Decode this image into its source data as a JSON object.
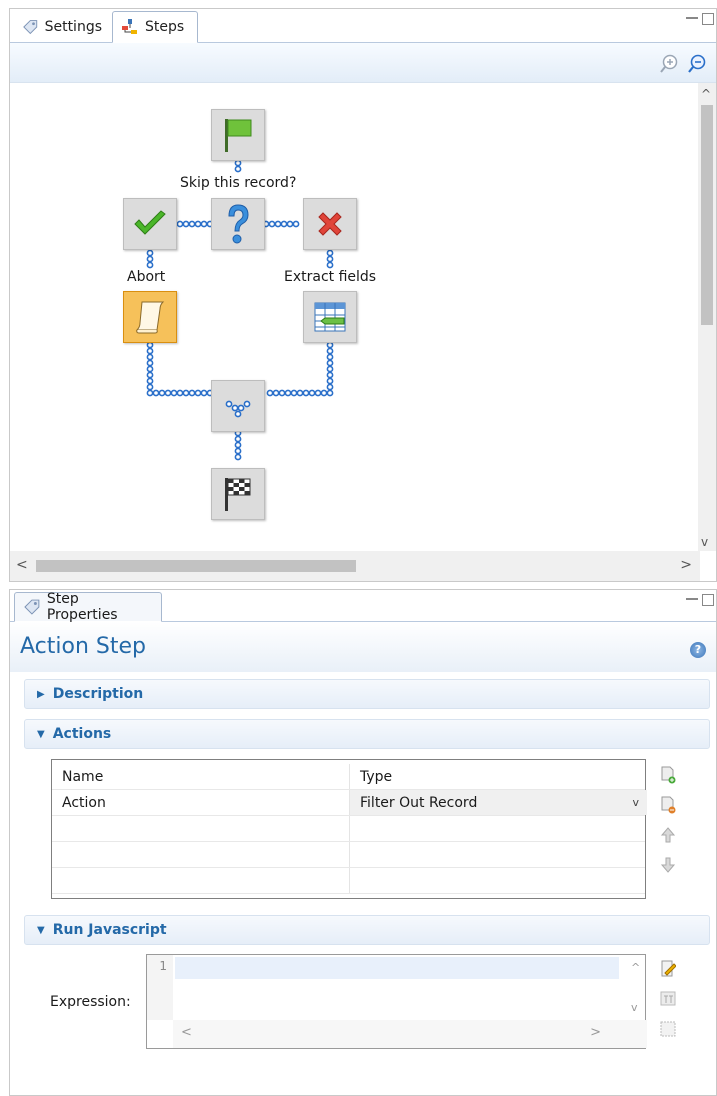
{
  "top": {
    "tabs": [
      {
        "label": "Settings",
        "icon": "settings-tab-icon"
      },
      {
        "label": "Steps",
        "icon": "steps-tab-icon"
      }
    ],
    "zoom_in_icon": "zoom-in-icon",
    "zoom_out_icon": "zoom-out-icon"
  },
  "flow": {
    "labels": {
      "question": "Skip this record?",
      "abort": "Abort",
      "extract": "Extract fields"
    },
    "nodes": [
      {
        "name": "start-node",
        "icon": "green-flag-icon"
      },
      {
        "name": "decision-node",
        "icon": "question-icon"
      },
      {
        "name": "yes-node",
        "icon": "check-icon"
      },
      {
        "name": "no-node",
        "icon": "cross-icon"
      },
      {
        "name": "abort-action-node",
        "icon": "script-icon",
        "selected": true
      },
      {
        "name": "extract-fields-node",
        "icon": "table-icon"
      },
      {
        "name": "merge-node",
        "icon": "merge-icon"
      },
      {
        "name": "end-node",
        "icon": "checkered-flag-icon"
      }
    ],
    "colors": {
      "connector": "#2a6fc9",
      "selected_fill": "#f6c15a"
    }
  },
  "properties": {
    "tab_label": "Step Properties",
    "title": "Action Step",
    "sections": {
      "description": "Description",
      "actions": "Actions",
      "run_javascript": "Run Javascript"
    },
    "actions_table": {
      "headers": [
        "Name",
        "Type"
      ],
      "rows": [
        {
          "name": "Action",
          "type": "Filter Out Record"
        }
      ]
    },
    "expression_label": "Expression:",
    "editor": {
      "line_number": "1"
    }
  }
}
